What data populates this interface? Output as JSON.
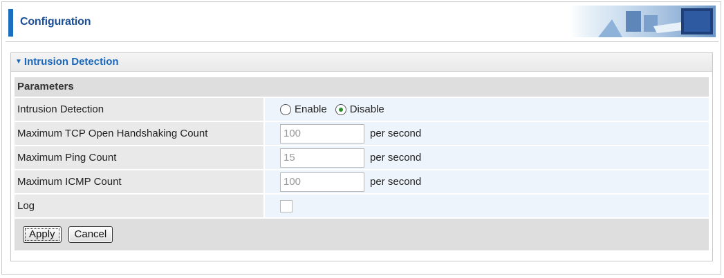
{
  "header": {
    "title": "Configuration"
  },
  "section": {
    "title": "Intrusion Detection"
  },
  "parameters": {
    "heading": "Parameters",
    "intrusion_detection": {
      "label": "Intrusion Detection",
      "options": [
        "Enable",
        "Disable"
      ],
      "selected": "Disable"
    },
    "tcp_handshake": {
      "label": "Maximum TCP Open Handshaking Count",
      "value": "100",
      "unit": "per second"
    },
    "ping_count": {
      "label": "Maximum Ping Count",
      "value": "15",
      "unit": "per second"
    },
    "icmp_count": {
      "label": "Maximum ICMP Count",
      "value": "100",
      "unit": "per second"
    },
    "log": {
      "label": "Log",
      "checked": false
    }
  },
  "actions": {
    "apply_label": "Apply",
    "cancel_label": "Cancel"
  },
  "colors": {
    "accent": "#1c6fc0",
    "section_title": "#1b67b8",
    "value_cell": "#eef4fb",
    "label_cell": "#e9e9e9"
  }
}
